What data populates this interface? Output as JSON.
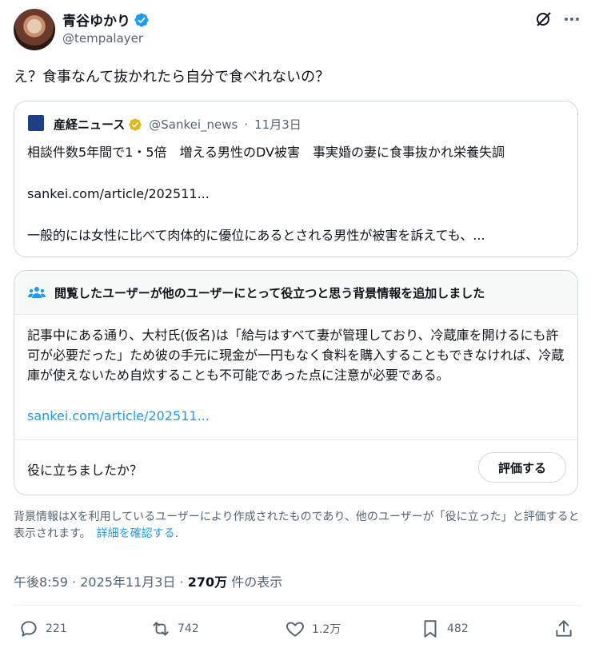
{
  "author": {
    "display_name": "青谷ゆかり",
    "handle": "@tempalayer",
    "verified_color": "#1d9bf0"
  },
  "tweet": {
    "text": "え？食事なんて抜かれたら自分で食べれないの？"
  },
  "quote": {
    "name": "産経ニュース",
    "handle": "@Sankei_news",
    "separator": "·",
    "date": "11月3日",
    "text": "相談件数5年間で1・5倍　増える男性のDV被害　事実婚の妻に食事抜かれ栄養失調",
    "link": "sankei.com/article/202511...",
    "text2": "一般的には女性に比べて肉体的に優位にあるとされる男性が被害を訴えても、..."
  },
  "community_note": {
    "title": "閲覧したユーザーが他のユーザーにとって役立つと思う背景情報を追加しました",
    "body": "記事中にある通り、大村氏(仮名)は「給与はすべて妻が管理しており、冷蔵庫を開けるにも許可が必要だった」ため彼の手元に現金が一円もなく食料を購入することもできなければ、冷蔵庫が使えないため自炊することも不可能であった点に注意が必要である。",
    "link": "sankei.com/article/202511...",
    "helpful_question": "役に立ちましたか？",
    "rate_button": "評価する"
  },
  "disclaimer": {
    "text": "背景情報はXを利用しているユーザーにより作成されたものであり、他のユーザーが「役に立った」と評価すると表示されます。",
    "link": "詳細を確認する",
    "period": "."
  },
  "meta": {
    "time": "午後8:59",
    "separator": "·",
    "date": "2025年11月3日",
    "views_count": "270万",
    "views_label": " 件の表示"
  },
  "actions": {
    "replies": "221",
    "reposts": "742",
    "likes": "1.2万",
    "bookmarks": "482"
  }
}
